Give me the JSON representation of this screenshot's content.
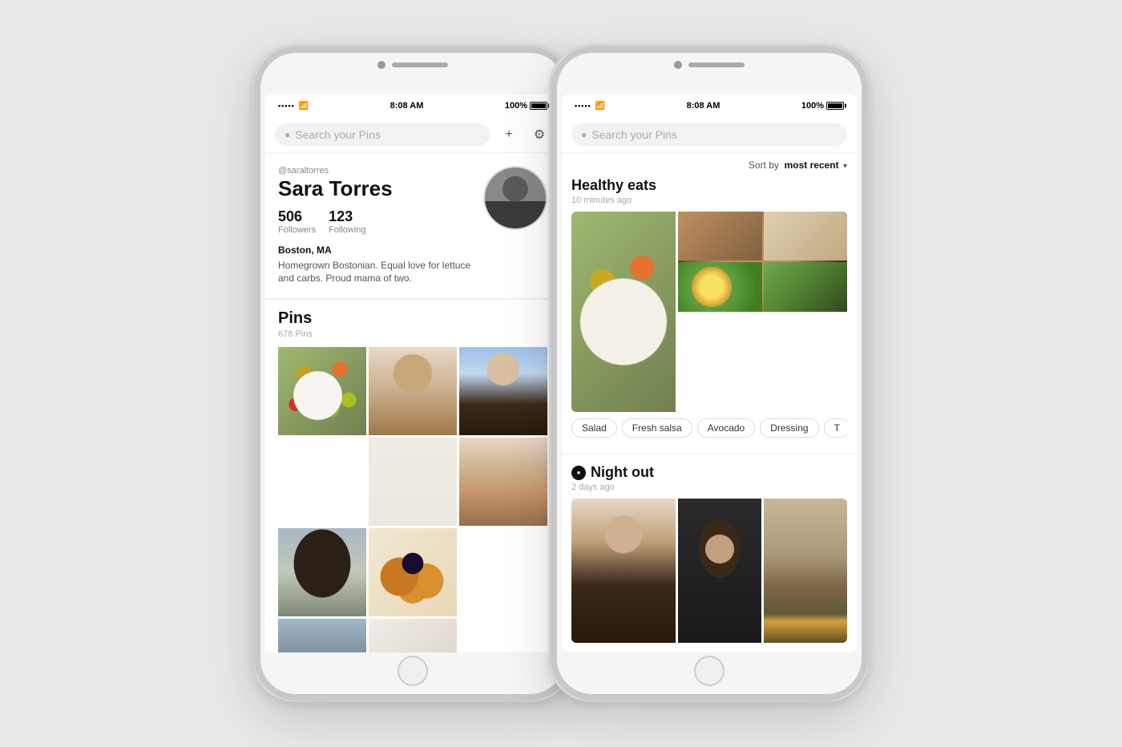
{
  "page": {
    "background": "#e8e8e8"
  },
  "phone1": {
    "status": {
      "time": "8:08 AM",
      "battery": "100%",
      "signal": "•••••",
      "wifi": "wifi"
    },
    "search": {
      "placeholder": "Search your Pins"
    },
    "profile": {
      "handle": "@saraltorres",
      "name": "Sara Torres",
      "followers_count": "506",
      "followers_label": "Followers",
      "following_count": "123",
      "following_label": "Following",
      "location": "Boston, MA",
      "bio": "Homegrown Bostonian. Equal love for lettuce and carbs. Proud mama of two."
    },
    "pins": {
      "title": "Pins",
      "count": "678 Pins"
    },
    "add_button": "+",
    "settings_button": "⚙"
  },
  "phone2": {
    "status": {
      "time": "8:08 AM",
      "battery": "100%",
      "signal": "•••••",
      "wifi": "wifi"
    },
    "search": {
      "placeholder": "Search your Pins"
    },
    "sort": {
      "label": "Sort by",
      "value": "most recent",
      "chevron": "▾"
    },
    "boards": [
      {
        "name": "Healthy eats",
        "time": "10 minutes ago",
        "has_icon": false,
        "tags": [
          "Salad",
          "Fresh salsa",
          "Avocado",
          "Dressing",
          "T"
        ]
      },
      {
        "name": "Night out",
        "time": "2 days ago",
        "has_icon": true,
        "icon": "●",
        "tags": []
      }
    ]
  }
}
